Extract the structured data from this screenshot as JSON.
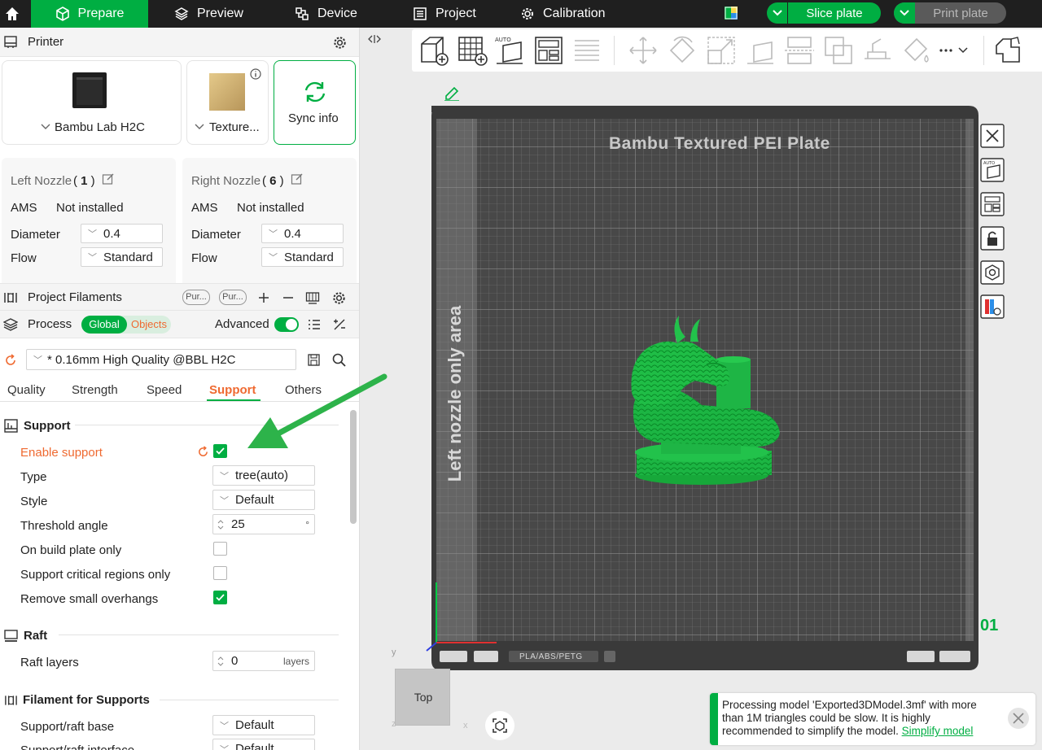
{
  "topbar": {
    "tabs": [
      {
        "label": "Prepare"
      },
      {
        "label": "Preview"
      },
      {
        "label": "Device"
      },
      {
        "label": "Project"
      },
      {
        "label": "Calibration"
      }
    ],
    "slice_label": "Slice plate",
    "print_label": "Print plate"
  },
  "printer": {
    "section_title": "Printer",
    "model": "Bambu Lab H2C",
    "plate": "Texture...",
    "sync_label": "Sync info"
  },
  "nozzles": {
    "left": {
      "title": "Left Nozzle",
      "number": "1",
      "ams_label": "AMS",
      "ams_value": "Not installed",
      "diameter_label": "Diameter",
      "diameter": "0.4",
      "flow_label": "Flow",
      "flow": "Standard"
    },
    "right": {
      "title": "Right Nozzle",
      "number": "6",
      "ams_label": "AMS",
      "ams_value": "Not installed",
      "diameter_label": "Diameter",
      "diameter": "0.4",
      "flow_label": "Flow",
      "flow": "Standard"
    }
  },
  "filaments": {
    "title": "Project Filaments",
    "chips": [
      "Pur...",
      "Pur..."
    ]
  },
  "process": {
    "title": "Process",
    "toggle_global": "Global",
    "toggle_objects": "Objects",
    "advanced_label": "Advanced",
    "preset": "* 0.16mm High Quality @BBL H2C",
    "subtabs": [
      "Quality",
      "Strength",
      "Speed",
      "Support",
      "Others"
    ],
    "active_subtab": "Support"
  },
  "support": {
    "section_title": "Support",
    "enable_label": "Enable support",
    "enable_checked": true,
    "type_label": "Type",
    "type_value": "tree(auto)",
    "style_label": "Style",
    "style_value": "Default",
    "threshold_label": "Threshold angle",
    "threshold_value": "25",
    "threshold_unit": "°",
    "build_plate_label": "On build plate only",
    "build_plate_checked": false,
    "critical_label": "Support critical regions only",
    "critical_checked": false,
    "overhangs_label": "Remove small overhangs",
    "overhangs_checked": true
  },
  "raft": {
    "section_title": "Raft",
    "layers_label": "Raft layers",
    "layers_value": "0",
    "layers_unit": "layers"
  },
  "filament_supports": {
    "section_title": "Filament for Supports",
    "base_label": "Support/raft base",
    "base_value": "Default",
    "interface_label": "Support/raft interface",
    "interface_value": "Default"
  },
  "viewport": {
    "plate_title": "Bambu Textured PEI Plate",
    "left_area_label": "Left nozzle only area",
    "plate_number": "01",
    "plate_material_tag": "PLA/ABS/PETG",
    "view_cube_label": "Top",
    "axis_y": "y",
    "axis_x": "x",
    "axis_z": "z"
  },
  "notification": {
    "text": "Processing model 'Exported3DModel.3mf' with more than 1M triangles could be slow. It is highly recommended to simplify the model.",
    "link": "Simplify model"
  },
  "colors": {
    "accent": "#00ae42",
    "warning": "#ef6a31",
    "topbar": "#1f1f1f",
    "plate": "#3a3a3a"
  }
}
